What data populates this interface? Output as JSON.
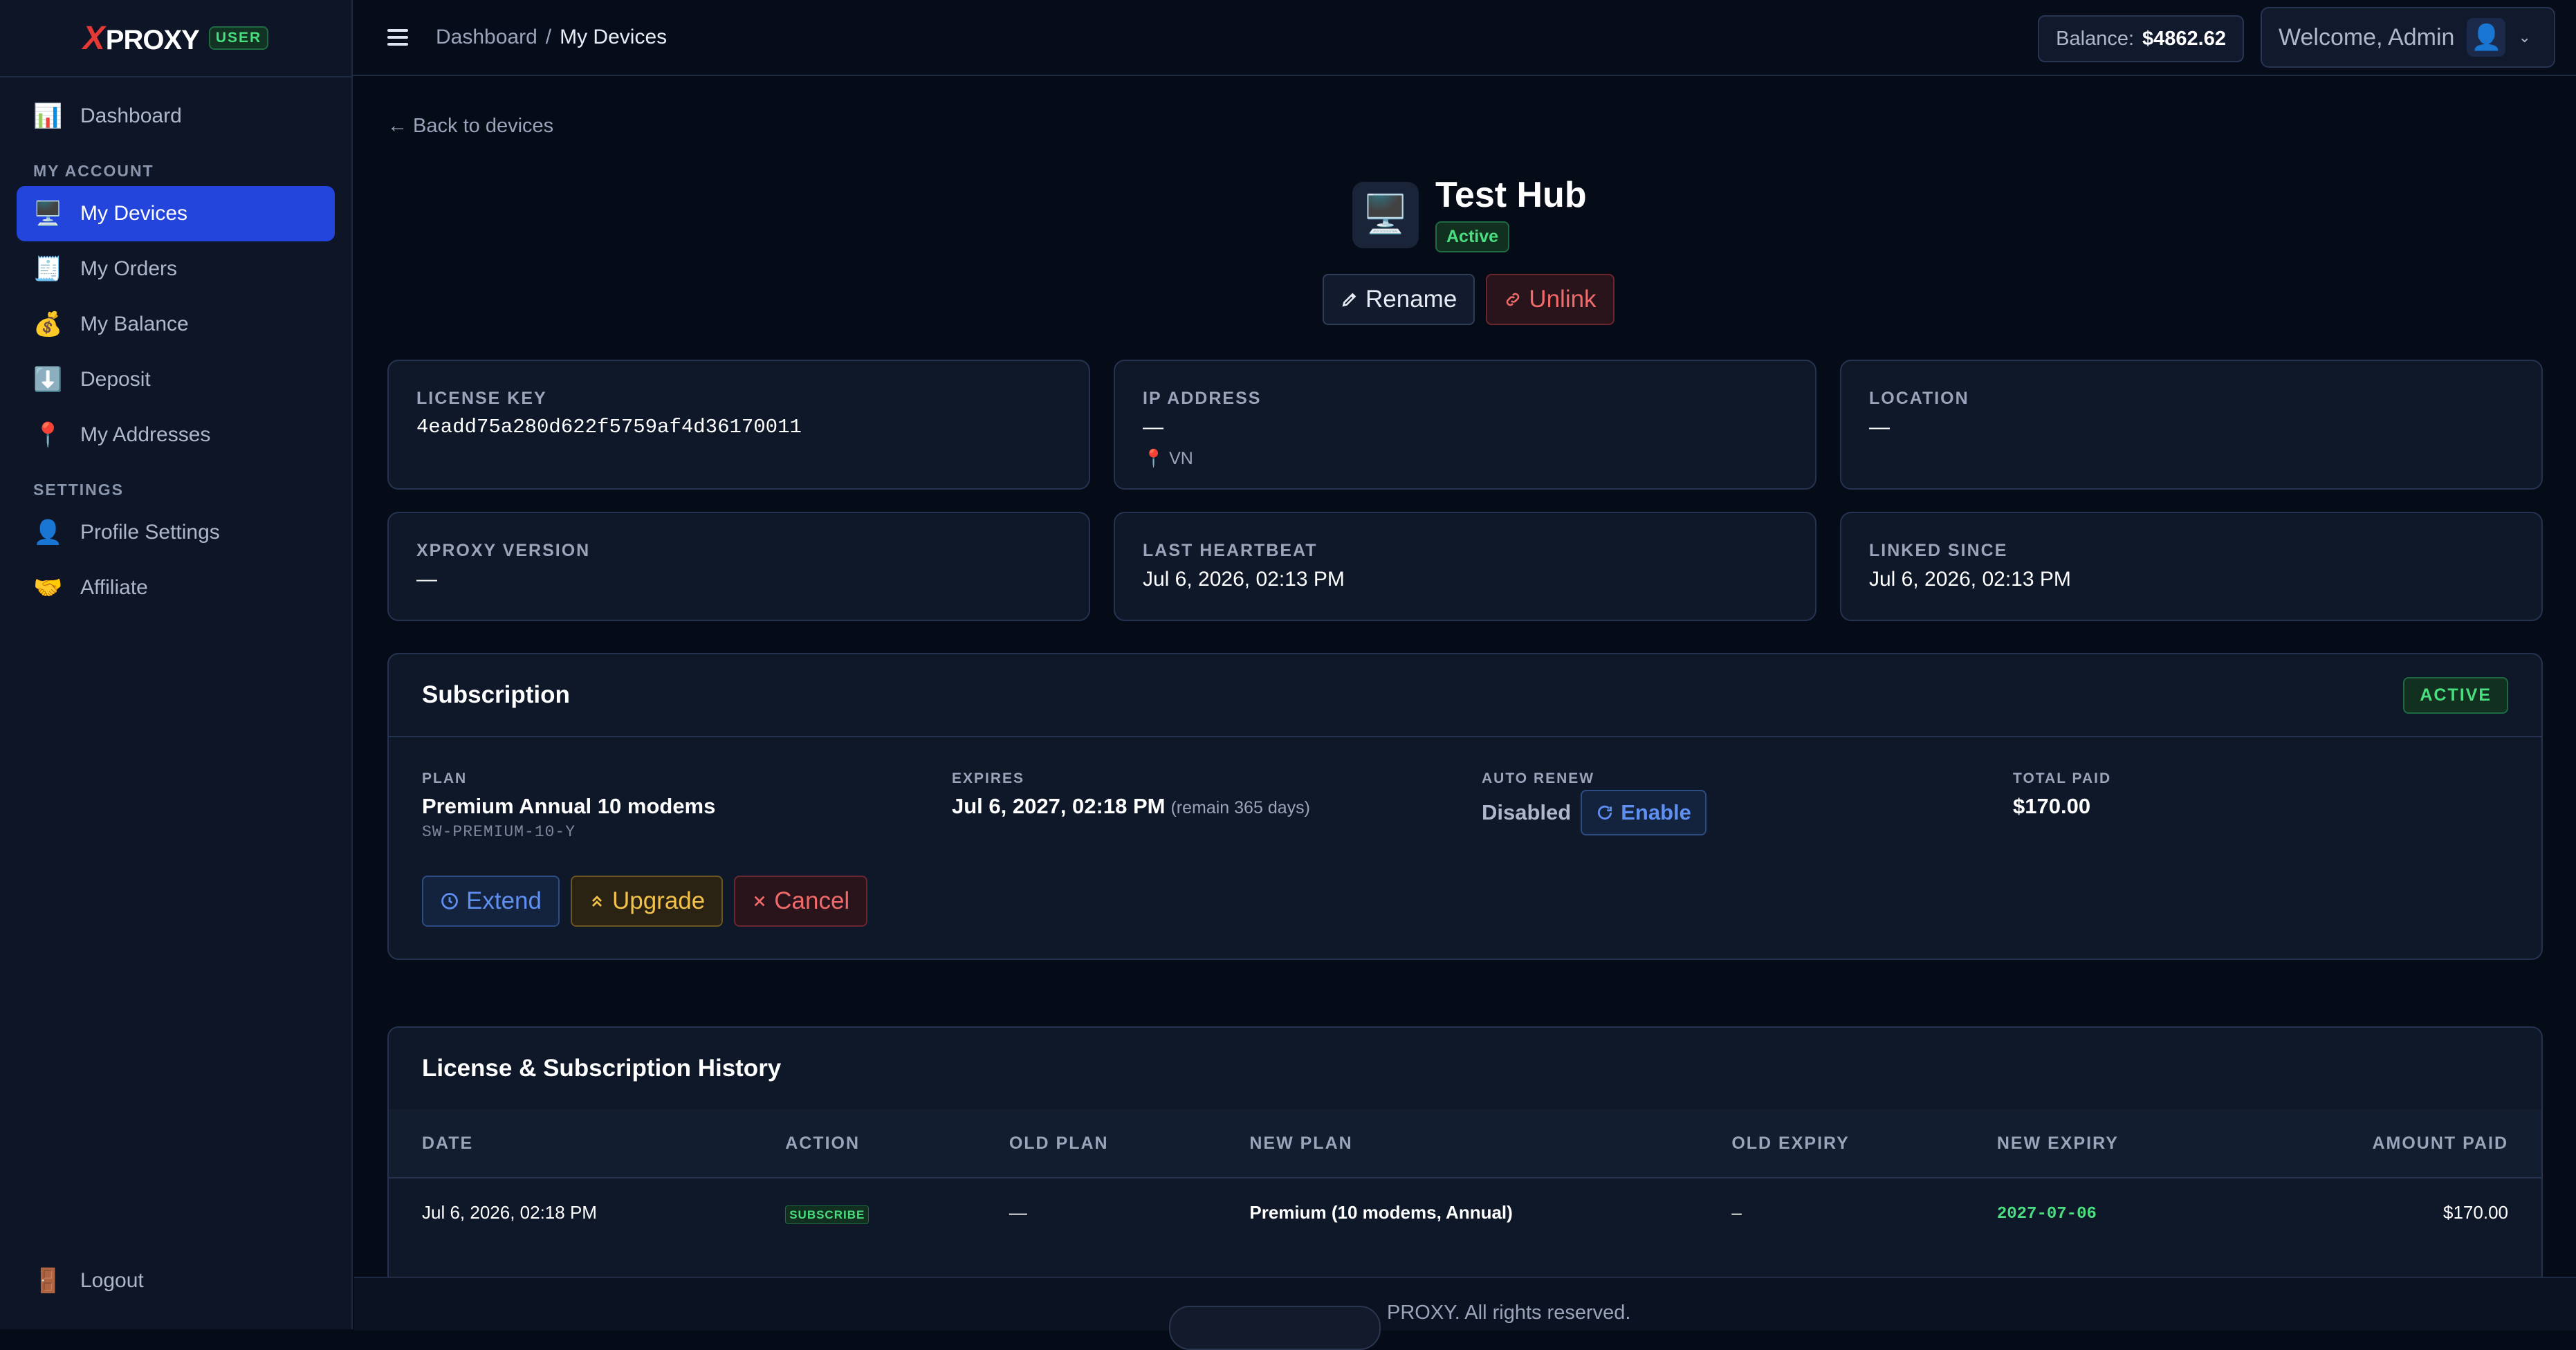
{
  "brand": {
    "logo_x": "X",
    "logo_rest": "PROXY",
    "badge": "USER"
  },
  "sidebar": {
    "items_top": [
      {
        "icon": "📊",
        "label": "Dashboard"
      }
    ],
    "section_account": "MY ACCOUNT",
    "items_account": [
      {
        "icon": "🖥️",
        "label": "My Devices",
        "active": true
      },
      {
        "icon": "🧾",
        "label": "My Orders"
      },
      {
        "icon": "💰",
        "label": "My Balance"
      },
      {
        "icon": "⬇️",
        "label": "Deposit"
      },
      {
        "icon": "📍",
        "label": "My Addresses"
      }
    ],
    "section_settings": "SETTINGS",
    "items_settings": [
      {
        "icon": "👤",
        "label": "Profile Settings"
      },
      {
        "icon": "🤝",
        "label": "Affiliate"
      }
    ],
    "logout": {
      "icon": "🚪",
      "label": "Logout"
    }
  },
  "topbar": {
    "breadcrumb_root": "Dashboard",
    "breadcrumb_sep": "/",
    "breadcrumb_current": "My Devices",
    "balance_label": "Balance:",
    "balance_value": "$4862.62",
    "welcome": "Welcome, Admin",
    "avatar_icon": "👤"
  },
  "device": {
    "back_link": "← Back to devices",
    "icon": "🖥️",
    "name": "Test Hub",
    "status": "Active",
    "rename_label": "Rename",
    "unlink_label": "Unlink"
  },
  "info_cards": {
    "license_key": {
      "label": "LICENSE KEY",
      "value": "4eadd75a280d622f5759af4d36170011"
    },
    "ip_address": {
      "label": "IP ADDRESS",
      "value": "—",
      "country": "📍 VN"
    },
    "location": {
      "label": "LOCATION",
      "value": "—"
    },
    "version": {
      "label": "XPROXY VERSION",
      "value": "—"
    },
    "heartbeat": {
      "label": "LAST HEARTBEAT",
      "value": "Jul 6, 2026, 02:13 PM"
    },
    "linked": {
      "label": "LINKED SINCE",
      "value": "Jul 6, 2026, 02:13 PM"
    }
  },
  "subscription": {
    "title": "Subscription",
    "status": "ACTIVE",
    "plan_label": "PLAN",
    "plan_name": "Premium Annual 10 modems",
    "plan_code": "SW-PREMIUM-10-Y",
    "expires_label": "EXPIRES",
    "expires_value": "Jul 6, 2027, 02:18 PM",
    "remain": "(remain 365 days)",
    "auto_renew_label": "AUTO RENEW",
    "auto_renew_value": "Disabled",
    "enable_label": "Enable",
    "total_paid_label": "TOTAL PAID",
    "total_paid_value": "$170.00",
    "extend_label": "Extend",
    "upgrade_label": "Upgrade",
    "cancel_label": "Cancel"
  },
  "history": {
    "title": "License & Subscription History",
    "columns": [
      "DATE",
      "ACTION",
      "OLD PLAN",
      "NEW PLAN",
      "OLD EXPIRY",
      "NEW EXPIRY",
      "AMOUNT PAID"
    ],
    "rows": [
      {
        "date": "Jul 6, 2026, 02:18 PM",
        "action": "SUBSCRIBE",
        "old_plan": "—",
        "new_plan": "Premium (10 modems, Annual)",
        "old_expiry": "–",
        "new_expiry": "2027-07-06",
        "amount": "$170.00"
      }
    ]
  },
  "footer": {
    "text": "PROXY. All rights reserved."
  }
}
